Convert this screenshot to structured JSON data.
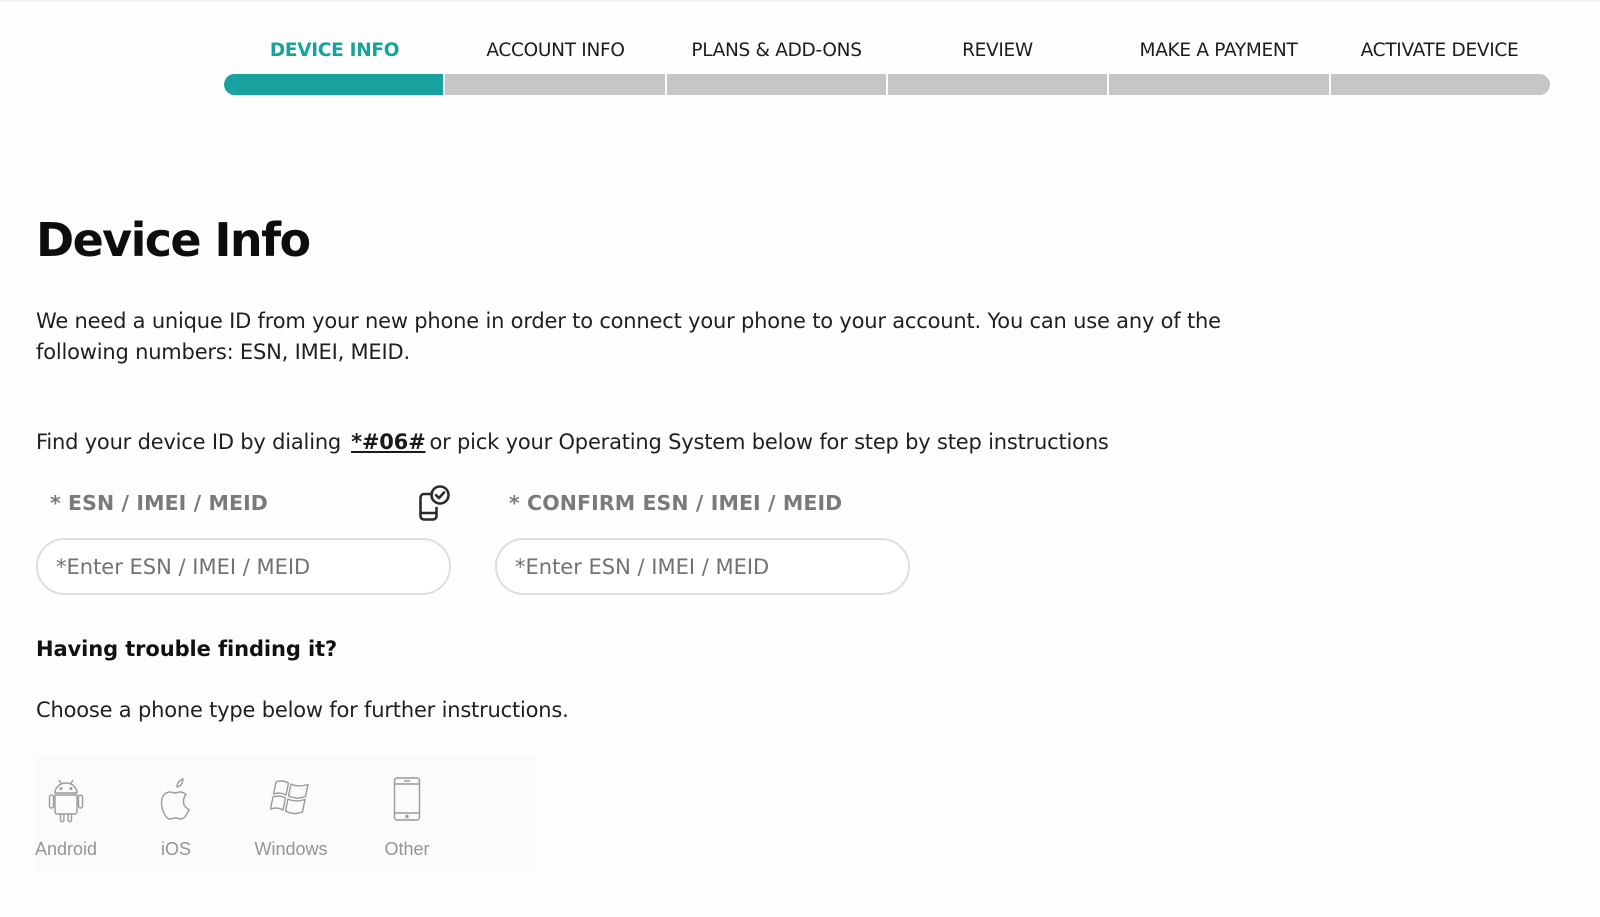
{
  "stepper": {
    "steps": [
      {
        "label": "DEVICE INFO",
        "active": true
      },
      {
        "label": "ACCOUNT INFO",
        "active": false
      },
      {
        "label": "PLANS & ADD-ONS",
        "active": false
      },
      {
        "label": "REVIEW",
        "active": false
      },
      {
        "label": "MAKE A PAYMENT",
        "active": false
      },
      {
        "label": "ACTIVATE DEVICE",
        "active": false
      }
    ],
    "current_step": 1,
    "total_steps": 6,
    "accent_color": "#17a2a0",
    "inactive_color": "#c6c6c6"
  },
  "page": {
    "title": "Device Info",
    "intro": "We need a unique ID from your new phone in order to connect your phone to your account. You can use any of the following numbers: ESN, IMEI, MEID.",
    "find_prefix": "Find your device ID by dialing",
    "dial_code": "*#06#",
    "find_suffix": "or pick your Operating System below for step by step instructions"
  },
  "form": {
    "esn_label": "* ESN / IMEI / MEID",
    "esn_placeholder": "*Enter ESN / IMEI / MEID",
    "esn_value": "",
    "confirm_label": "* CONFIRM ESN / IMEI / MEID",
    "confirm_placeholder": "*Enter ESN / IMEI / MEID",
    "confirm_value": "",
    "check_icon": "device-check-icon"
  },
  "help": {
    "heading": "Having trouble finding it?",
    "text": "Choose a phone type below for further instructions.",
    "os_options": [
      {
        "label": "Android",
        "icon": "android-icon"
      },
      {
        "label": "iOS",
        "icon": "apple-icon"
      },
      {
        "label": "Windows",
        "icon": "windows-icon"
      },
      {
        "label": "Other",
        "icon": "phone-icon"
      }
    ]
  }
}
